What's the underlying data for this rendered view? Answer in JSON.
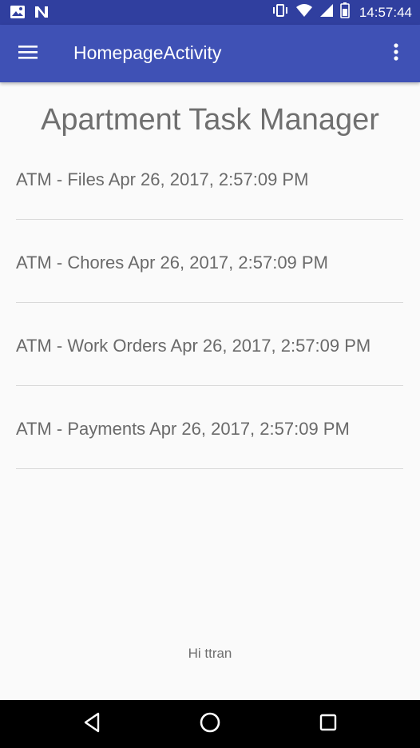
{
  "status_bar": {
    "time": "14:57:44",
    "icons": [
      "image-icon",
      "n-logo-icon",
      "vibrate-icon",
      "wifi-icon",
      "signal-icon",
      "battery-icon"
    ]
  },
  "app_bar": {
    "title": "HomepageActivity",
    "color": "#3f51b5",
    "status_color": "#303f9f"
  },
  "main": {
    "title": "Apartment Task Manager",
    "tasks": [
      {
        "label": "ATM - Files Apr 26, 2017, 2:57:09 PM"
      },
      {
        "label": "ATM - Chores Apr 26, 2017, 2:57:09 PM"
      },
      {
        "label": "ATM - Work Orders Apr 26, 2017, 2:57:09 PM"
      },
      {
        "label": "ATM - Payments Apr 26, 2017, 2:57:09 PM"
      }
    ],
    "greeting": "Hi ttran"
  },
  "nav_bar": {
    "buttons": [
      "back-icon",
      "home-icon",
      "recents-icon"
    ]
  }
}
